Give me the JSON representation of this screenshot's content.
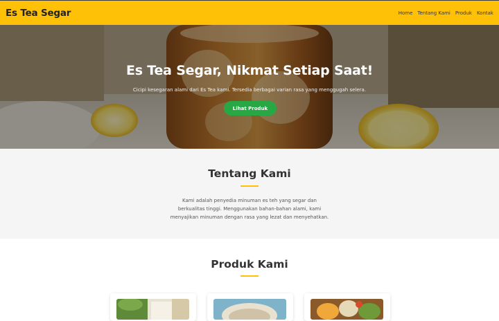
{
  "navbar": {
    "brand": "Es Tea Segar",
    "links": [
      "Home",
      "Tentang Kami",
      "Produk",
      "Kontak"
    ]
  },
  "hero": {
    "title": "Es Tea Segar, Nikmat Setiap Saat!",
    "subtitle": "Cicipi kesegaran alami dari Es Tea kami. Tersedia berbagai varian rasa yang menggugah selera.",
    "cta_label": "Lihat Produk"
  },
  "about": {
    "heading": "Tentang Kami",
    "lines": [
      "Kami adalah penyedia minuman es teh yang segar dan",
      "berkualitas tinggi. Menggunakan bahan-bahan alami, kami",
      "menyajikan minuman dengan rasa yang lezat dan menyehatkan."
    ]
  },
  "products": {
    "heading": "Produk Kami"
  },
  "colors": {
    "accent": "#ffc107",
    "cta": "#28a745",
    "section_bg": "#f5f5f5"
  }
}
